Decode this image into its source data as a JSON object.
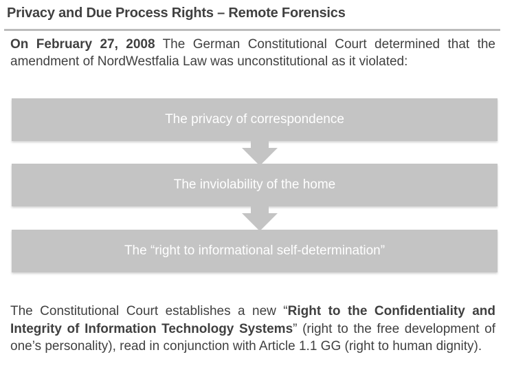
{
  "slide": {
    "title": "Privacy and Due Process Rights – Remote Forensics",
    "intro": {
      "date_bold": "On February 27, 2008",
      "text": " The German Constitutional Court determined that the amendment of NordWestfalia Law was unconstitutional as it violated:"
    },
    "flow_items": [
      "The privacy of correspondence",
      "The inviolability of the home",
      "The “right to informational self-determination”"
    ],
    "conclusion": {
      "part1": "The Constitutional Court establishes a new “",
      "bold": "Right to the Confidentiality and Integrity of Information Technology Systems",
      "part2": "” (right to the free development of one’s personality), read in conjunction with Article 1.1 GG (right to human dignity)."
    }
  }
}
